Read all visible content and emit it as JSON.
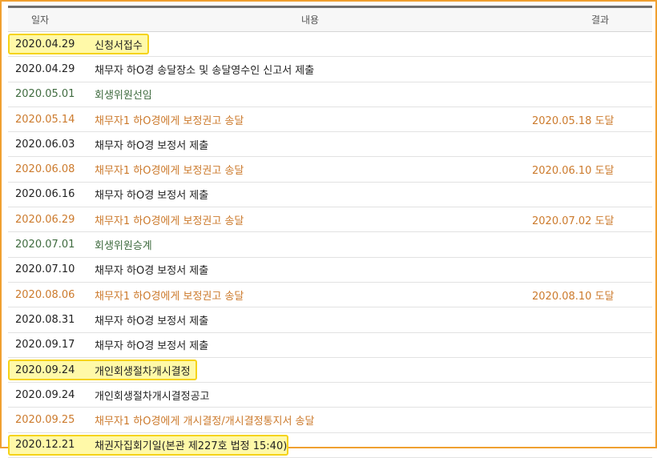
{
  "header": {
    "date": "일자",
    "content": "내용",
    "result": "결과"
  },
  "rows": [
    {
      "date": "2020.04.29",
      "content": "신청서접수",
      "result": "",
      "color": "black",
      "highlight": true
    },
    {
      "date": "2020.04.29",
      "content": "채무자 하O경 송달장소 및 송달영수인 신고서 제출",
      "result": "",
      "color": "black",
      "highlight": false
    },
    {
      "date": "2020.05.01",
      "content": "회생위원선임",
      "result": "",
      "color": "green",
      "highlight": false
    },
    {
      "date": "2020.05.14",
      "content": "채무자1 하O경에게 보정권고 송달",
      "result": "2020.05.18 도달",
      "color": "orange",
      "highlight": false
    },
    {
      "date": "2020.06.03",
      "content": "채무자 하O경 보정서 제출",
      "result": "",
      "color": "black",
      "highlight": false
    },
    {
      "date": "2020.06.08",
      "content": "채무자1 하O경에게 보정권고 송달",
      "result": "2020.06.10 도달",
      "color": "orange",
      "highlight": false
    },
    {
      "date": "2020.06.16",
      "content": "채무자 하O경 보정서 제출",
      "result": "",
      "color": "black",
      "highlight": false
    },
    {
      "date": "2020.06.29",
      "content": "채무자1 하O경에게 보정권고 송달",
      "result": "2020.07.02 도달",
      "color": "orange",
      "highlight": false
    },
    {
      "date": "2020.07.01",
      "content": "회생위원승계",
      "result": "",
      "color": "green",
      "highlight": false
    },
    {
      "date": "2020.07.10",
      "content": "채무자 하O경 보정서 제출",
      "result": "",
      "color": "black",
      "highlight": false
    },
    {
      "date": "2020.08.06",
      "content": "채무자1 하O경에게 보정권고 송달",
      "result": "2020.08.10 도달",
      "color": "orange",
      "highlight": false
    },
    {
      "date": "2020.08.31",
      "content": "채무자 하O경 보정서 제출",
      "result": "",
      "color": "black",
      "highlight": false
    },
    {
      "date": "2020.09.17",
      "content": "채무자 하O경 보정서 제출",
      "result": "",
      "color": "black",
      "highlight": false
    },
    {
      "date": "2020.09.24",
      "content": "개인회생절차개시결정",
      "result": "",
      "color": "black",
      "highlight": true
    },
    {
      "date": "2020.09.24",
      "content": "개인회생절차개시결정공고",
      "result": "",
      "color": "black",
      "highlight": false
    },
    {
      "date": "2020.09.25",
      "content": "채무자1 하O경에게 개시결정/개시결정통지서 송달",
      "result": "",
      "color": "orange",
      "highlight": false
    },
    {
      "date": "2020.12.21",
      "content": "채권자집회기일(본관 제227호 법정 15:40)",
      "result": "",
      "color": "black",
      "highlight": true
    }
  ]
}
